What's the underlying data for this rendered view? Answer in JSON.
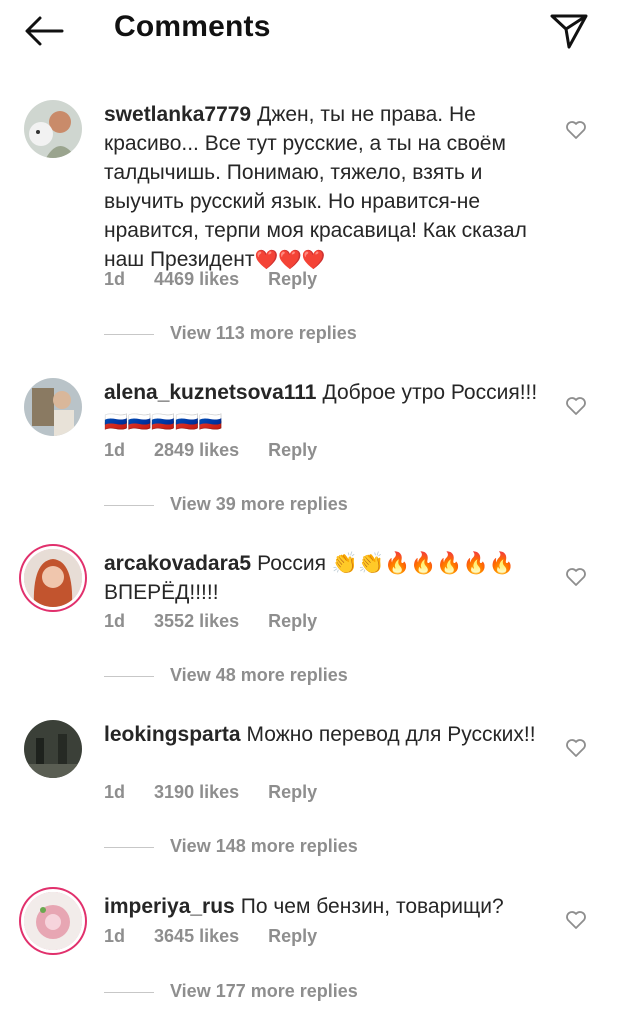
{
  "header": {
    "title": "Comments",
    "back_icon": "arrow-left-icon",
    "share_icon": "paper-plane-icon"
  },
  "comments": [
    {
      "username": "swetlanka7779",
      "text": "Джен, ты не права. Не красиво... Все тут русские, а ты на своём талдычишь. Понимаю, тяжело, взять и выучить русский язык. Но нравится-не нравится, терпи моя красавица! Как сказал наш Президент",
      "emoji": "❤️❤️❤️",
      "time": "1d",
      "likes": "4469 likes",
      "reply": "Reply",
      "view_replies": "View 113 more replies"
    },
    {
      "username": "alena_kuznetsova111",
      "text": "Доброе утро Россия!!!",
      "emoji": "🇷🇺🇷🇺🇷🇺🇷🇺🇷🇺",
      "time": "1d",
      "likes": "2849 likes",
      "reply": "Reply",
      "view_replies": "View 39 more replies"
    },
    {
      "username": "arcakovadara5",
      "text": "Россия 👏👏🔥🔥🔥🔥🔥 ВПЕРЁД!!!!!",
      "emoji": "",
      "time": "1d",
      "likes": "3552 likes",
      "reply": "Reply",
      "view_replies": "View 48 more replies"
    },
    {
      "username": "leokingsparta",
      "text": "Можно перевод для Русских!!",
      "emoji": "",
      "time": "1d",
      "likes": "3190 likes",
      "reply": "Reply",
      "view_replies": "View 148 more replies"
    },
    {
      "username": "imperiya_rus",
      "text": "По чем бензин, товарищи?",
      "emoji": "",
      "time": "1d",
      "likes": "3645 likes",
      "reply": "Reply",
      "view_replies": "View 177 more replies"
    }
  ],
  "colors": {
    "text": "#262626",
    "secondary": "#8e8e8e",
    "story_ring": "#e1306c"
  }
}
